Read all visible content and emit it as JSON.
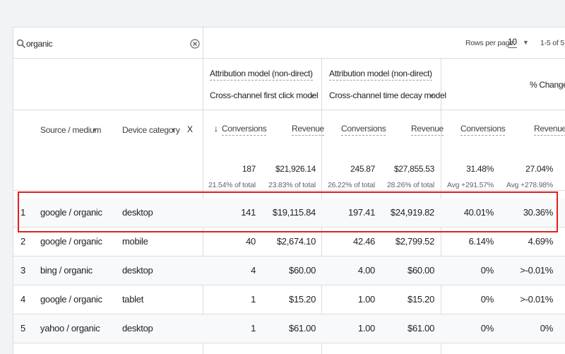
{
  "search": {
    "value": "organic"
  },
  "pagination": {
    "rows_per_page_label": "Rows per page:",
    "rows_per_page_value": "10",
    "range": "1-5 of 5"
  },
  "models": [
    {
      "label": "Attribution model (non-direct)",
      "value": "Cross-channel first click model"
    },
    {
      "label": "Attribution model (non-direct)",
      "value": "Cross-channel time decay model"
    }
  ],
  "percent_change_label": "% Change",
  "dimensions": {
    "source_medium": "Source / medium",
    "device_category": "Device category",
    "remove": "X"
  },
  "metrics": {
    "m1_conversions": "Conversions",
    "m1_revenue": "Revenue",
    "m2_conversions": "Conversions",
    "m2_revenue": "Revenue",
    "pc_conversions": "Conversions",
    "pc_revenue": "Revenue"
  },
  "totals": {
    "m1_conversions": {
      "value": "187",
      "sub": "21.54% of total"
    },
    "m1_revenue": {
      "value": "$21,926.14",
      "sub": "23.83% of total"
    },
    "m2_conversions": {
      "value": "245.87",
      "sub": "26.22% of total"
    },
    "m2_revenue": {
      "value": "$27,855.53",
      "sub": "28.26% of total"
    },
    "pc_conversions": {
      "value": "31.48%",
      "sub": "Avg +291.57%"
    },
    "pc_revenue": {
      "value": "27.04%",
      "sub": "Avg +278.98%"
    }
  },
  "rows": [
    {
      "index": "1",
      "source": "google / organic",
      "device": "desktop",
      "c1": "141",
      "r1": "$19,115.84",
      "c2": "197.41",
      "r2": "$24,919.82",
      "pc": "40.01%",
      "pr": "30.36%"
    },
    {
      "index": "2",
      "source": "google / organic",
      "device": "mobile",
      "c1": "40",
      "r1": "$2,674.10",
      "c2": "42.46",
      "r2": "$2,799.52",
      "pc": "6.14%",
      "pr": "4.69%"
    },
    {
      "index": "3",
      "source": "bing / organic",
      "device": "desktop",
      "c1": "4",
      "r1": "$60.00",
      "c2": "4.00",
      "r2": "$60.00",
      "pc": "0%",
      "pr": ">-0.01%"
    },
    {
      "index": "4",
      "source": "google / organic",
      "device": "tablet",
      "c1": "1",
      "r1": "$15.20",
      "c2": "1.00",
      "r2": "$15.20",
      "pc": "0%",
      "pr": ">-0.01%"
    },
    {
      "index": "5",
      "source": "yahoo / organic",
      "device": "desktop",
      "c1": "1",
      "r1": "$61.00",
      "c2": "1.00",
      "r2": "$61.00",
      "pc": "0%",
      "pr": "0%"
    }
  ],
  "colors": {
    "highlight": "#e0201f",
    "border": "#dadce0",
    "alt_row": "#f8f9fa"
  }
}
